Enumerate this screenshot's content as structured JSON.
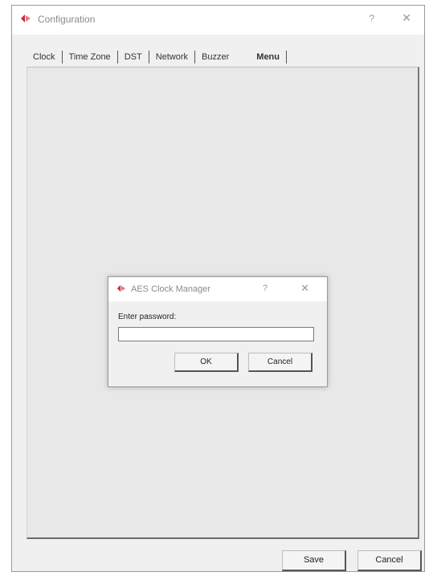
{
  "window": {
    "title": "Configuration",
    "help_glyph": "?",
    "close_glyph": "✕"
  },
  "tabs": [
    {
      "label": "Clock",
      "active": false
    },
    {
      "label": "Time Zone",
      "active": false
    },
    {
      "label": "DST",
      "active": false
    },
    {
      "label": "Network",
      "active": false
    },
    {
      "label": "Buzzer",
      "active": false
    },
    {
      "label": "Menu",
      "active": true
    }
  ],
  "footer": {
    "save_label": "Save",
    "cancel_label": "Cancel"
  },
  "dialog": {
    "title": "AES Clock Manager",
    "help_glyph": "?",
    "close_glyph": "✕",
    "prompt": "Enter password:",
    "password_value": "",
    "ok_label": "OK",
    "cancel_label": "Cancel"
  },
  "icons": {
    "app": "aes-logo-icon",
    "dialog": "aes-logo-icon"
  },
  "colors": {
    "logo_red": "#d1283a",
    "window_bg": "#f0f0f0",
    "panel_bg": "#e8e8e8"
  }
}
